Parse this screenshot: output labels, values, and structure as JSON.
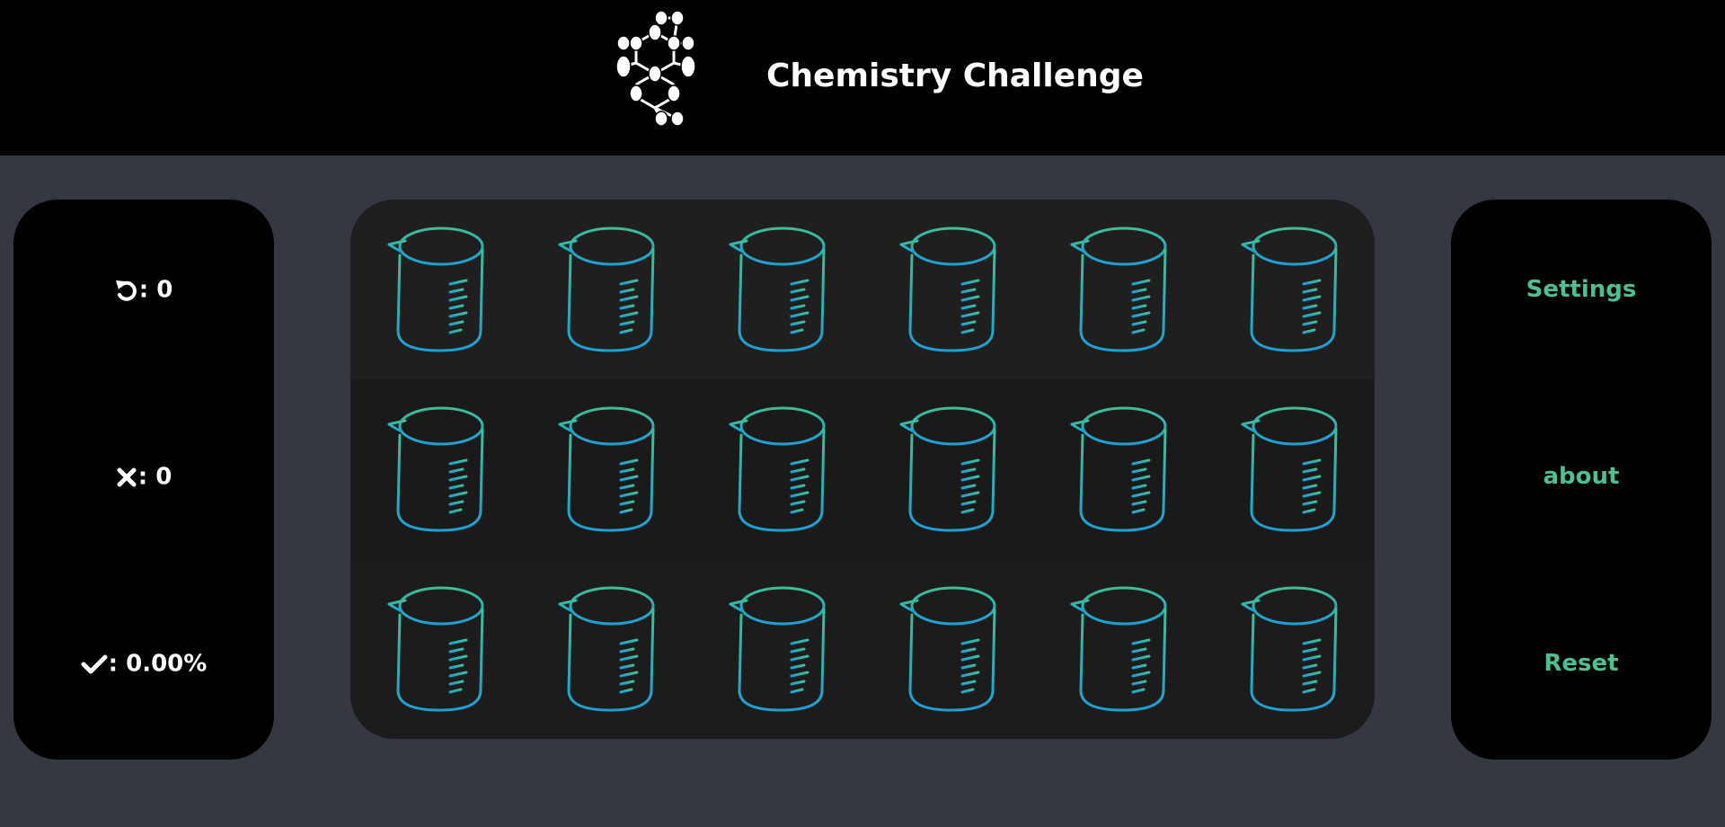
{
  "header": {
    "title": "Chemistry Challenge",
    "logo_icon": "molecule-logo-icon"
  },
  "stats": {
    "attempts": {
      "icon": "undo-arrow-icon",
      "separator": ":",
      "value": "0"
    },
    "mistakes": {
      "icon": "cross-icon",
      "separator": ":",
      "value": "0"
    },
    "accuracy": {
      "icon": "check-icon",
      "separator": ":",
      "value": "0.00%"
    }
  },
  "menu": {
    "settings": "Settings",
    "about": "about",
    "reset": "Reset"
  },
  "board": {
    "rows": 3,
    "columns": 6,
    "tile_icon": "beaker-icon"
  },
  "colors": {
    "background": "#343840",
    "panel": "#000000",
    "board": "#1b1b1b",
    "accent_green": "#4fbf8f",
    "beaker_top": "#3dbf95",
    "beaker_bottom": "#1e9fd6",
    "text": "#ffffff"
  }
}
